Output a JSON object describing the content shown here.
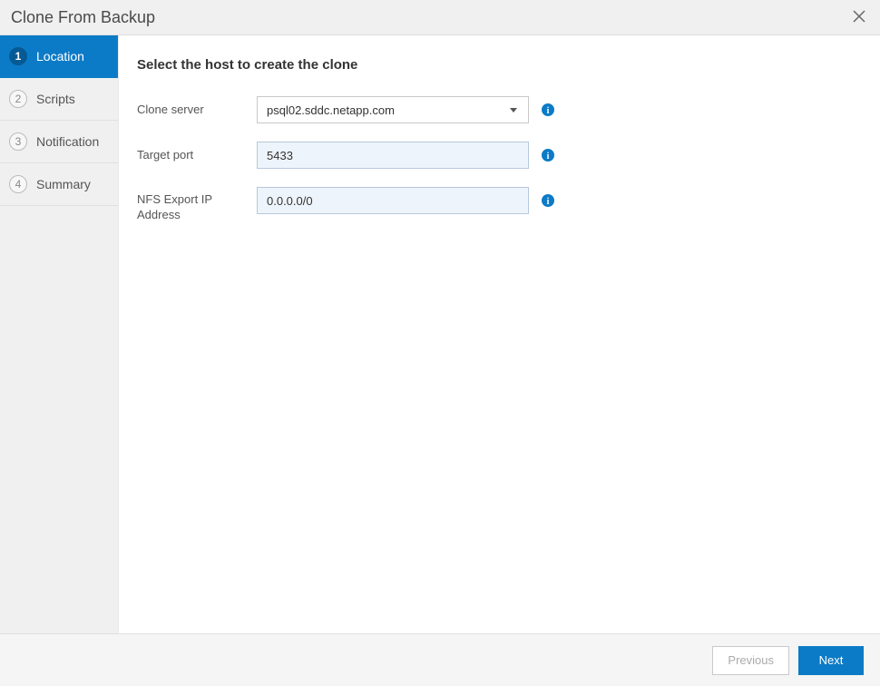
{
  "title": "Clone From Backup",
  "steps": [
    {
      "num": "1",
      "label": "Location",
      "active": true
    },
    {
      "num": "2",
      "label": "Scripts",
      "active": false
    },
    {
      "num": "3",
      "label": "Notification",
      "active": false
    },
    {
      "num": "4",
      "label": "Summary",
      "active": false
    }
  ],
  "heading": "Select the host to create the clone",
  "form": {
    "clone_server_label": "Clone server",
    "clone_server_value": "psql02.sddc.netapp.com",
    "target_port_label": "Target port",
    "target_port_value": "5433",
    "nfs_label": "NFS Export IP Address",
    "nfs_value": "0.0.0.0/0"
  },
  "buttons": {
    "previous": "Previous",
    "next": "Next"
  }
}
